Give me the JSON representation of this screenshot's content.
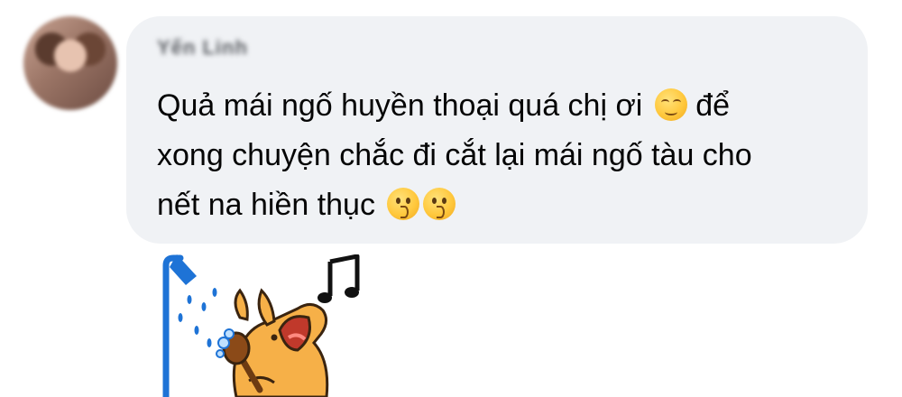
{
  "comment": {
    "author_name": "Yến Linh",
    "line_1": "Quả mái ngố huyền thoại quá chị ơi",
    "line_1_end": "để",
    "line_2": "xong chuyện chắc đi cắt lại mái ngố tàu cho",
    "line_3": "nết na hiền thục",
    "emojis": [
      "relieved-face",
      "kissing-face",
      "kissing-face"
    ]
  },
  "sticker": {
    "name": "dog-singing-in-shower-sticker",
    "colors": {
      "shower": "#1e73d6",
      "fur": "#f6b048",
      "note": "#111111"
    }
  }
}
